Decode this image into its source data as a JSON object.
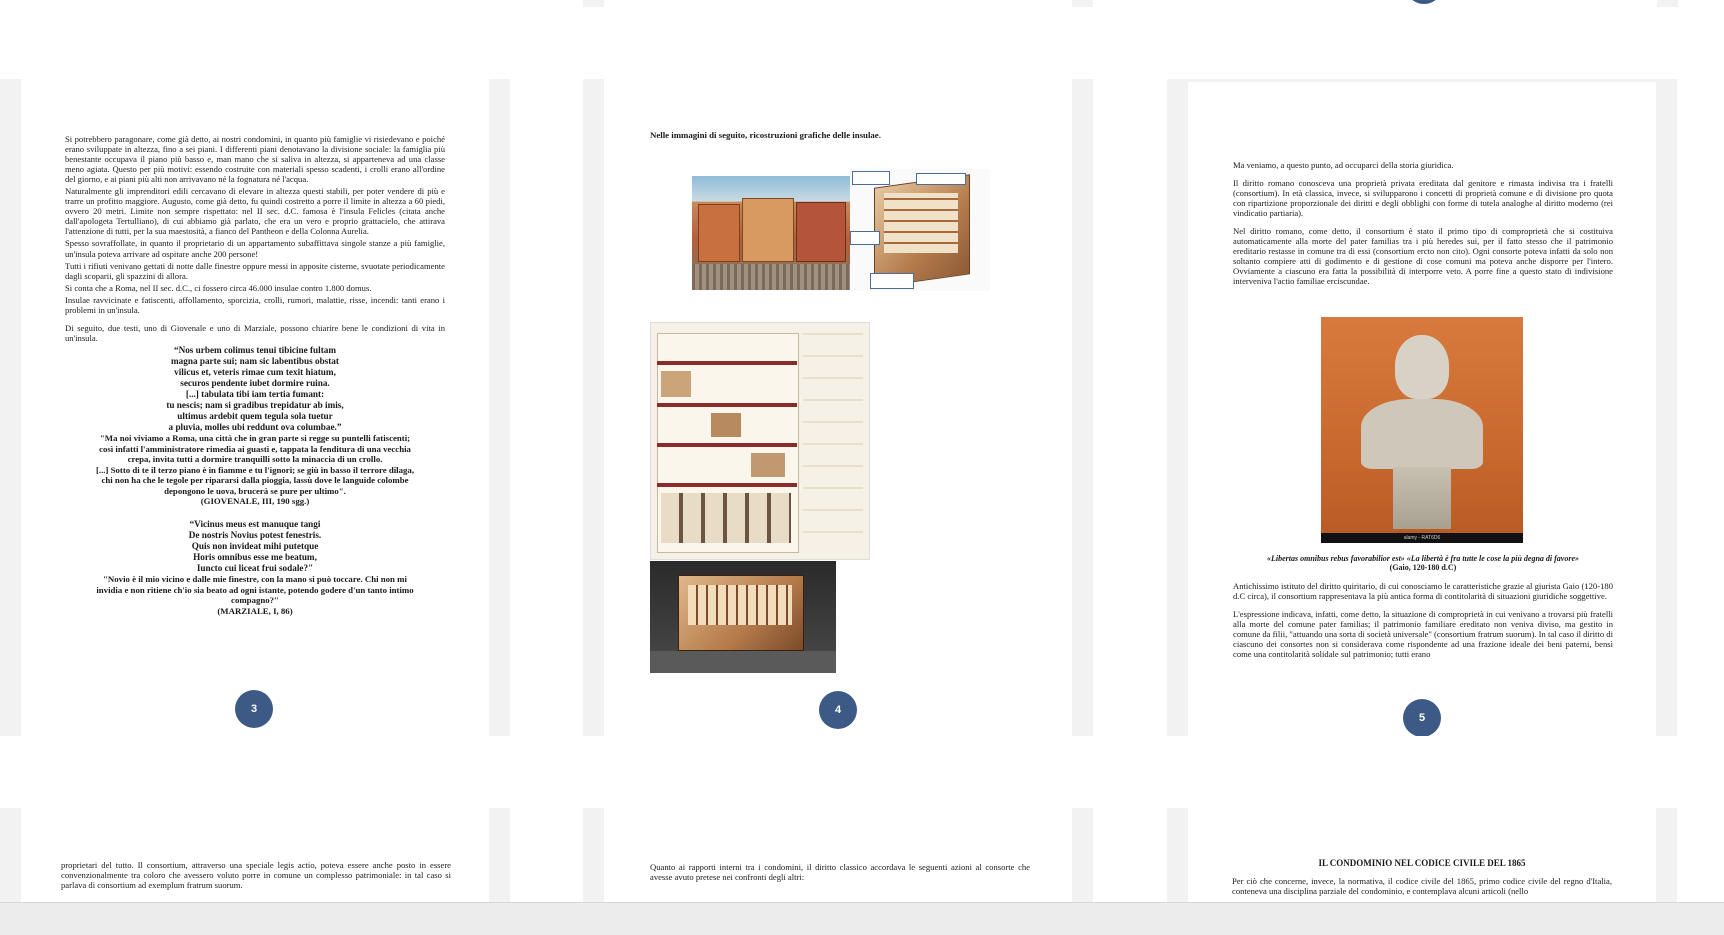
{
  "page3": {
    "number": "3",
    "paragraphs": [
      "Si potrebbero paragonare, come già detto, ai nostri condomini, in quanto più famiglie vi risiedevano e poiché erano sviluppate in altezza, fino a sei piani. I differenti piani denotavano la divisione sociale: la famiglia più benestante occupava il piano più basso e, man mano che si saliva in altezza, si apparteneva ad una classe meno agiata. Questo per più motivi: essendo costruite con materiali spesso scadenti, i crolli erano all'ordine del giorno, e ai piani più alti non arrivavano né la fognatura né l'acqua.",
      "Naturalmente gli imprenditori edili cercavano di elevare in altezza questi stabili, per poter vendere di più e trarre un profitto maggiore. Augusto, come già detto, fu quindi costretto a porre il limite in altezza a 60 piedi, ovvero 20 metri. Limite non sempre rispettato: nel II sec. d.C. famosa è l'insula Felicles (citata anche dall'apologeta Tertulliano), di cui abbiamo già parlato, che era un vero e proprio grattacielo, che attirava l'attenzione di tutti, per la sua maestosità, a fianco del Pantheon e della Colonna Aurelia.",
      "Spesso sovraffollate, in quanto il proprietario di un appartamento subaffittava singole stanze a più famiglie, un'insula poteva arrivare ad ospitare anche 200 persone!",
      "Tutti i rifiuti venivano gettati di notte dalle finestre oppure messi in apposite cisterne, svuotate periodicamente dagli scoparii, gli spazzini di allora.",
      "Si conta che a Roma, nel II sec. d.C., ci fossero circa 46.000 insulae contro 1.800 domus.",
      "Insulae ravvicinate e fatiscenti, affollamento, sporcizia, crolli, rumori, malattie, risse, incendi: tanti erano i problemi in un'insula."
    ],
    "intro_poems": "Di seguito, due testi, uno di Giovenale e uno di Marziale, possono chiarire bene le condizioni di vita in un'insula.",
    "juvenal_latin": [
      "“Nos urbem colimus tenui tibicine fultam",
      "magna parte sui; nam sic labentibus obstat",
      "vilicus et, veteris rimae cum texit hiatum,",
      "securos pendente iubet dormire ruina.",
      "[...] tabulata tibi iam tertia fumant:",
      "tu nescis; nam si gradibus trepidatur ab imis,",
      "ultimus ardebit quem tegula sola tuetur",
      "a pluvia, molles ubi reddunt ova columbae.”"
    ],
    "juvenal_italian": [
      "\"Ma noi viviamo a Roma, una città che in gran parte si regge su puntelli fatiscenti;",
      "così infatti l'amministratore rimedia ai guasti e, tappata la fenditura di una vecchia",
      "crepa, invita tutti a dormire tranquilli sotto la minaccia di un crollo.",
      "[...] Sotto di te il terzo piano è in fiamme e tu l'ignori; se giù in basso il terrore dilaga,",
      "chi non ha che le tegole per ripararsi dalla pioggia, lassù dove le languide colombe",
      "depongono le uova, brucerà se pure per ultimo\"."
    ],
    "juvenal_ref": "(GIOVENALE, III, 190 sgg.)",
    "martial_latin": [
      "“Vicinus meus est manuque tangi",
      "De nostris Novius potest fenestris.",
      "Quis non invideat mihi putetque",
      "Horis omnibus esse me beatum,",
      "Iuncto cui liceat frui sodale?\""
    ],
    "martial_italian": [
      "\"Novio è il mio vicino e dalle mie finestre, con la mano si può toccare. Chi non mi",
      "invidia e non ritiene ch'io sia beato ad ogni istante, potendo godere d'un tanto intimo",
      "compagno?\""
    ],
    "martial_ref": "(MARZIALE, I, 86)"
  },
  "page4": {
    "number": "4",
    "heading": "Nelle immagini di seguito, ricostruzioni grafiche delle insulae."
  },
  "page5": {
    "number": "5",
    "p1": "Ma veniamo, a questo punto, ad occuparci della storia giuridica.",
    "p2": "Il diritto romano conosceva una proprietà privata ereditata dal genitore e rimasta indivisa tra i fratelli (consortium). In età classica, invece, si svilupparono i concetti di proprietà comune e di divisione pro quota con ripartizione proporzionale dei diritti e degli obblighi con forme di tutela analoghe al diritto moderno (rei vindicatio partiaria).",
    "p3": "Nel diritto romano, come detto, il consortium è stato il primo tipo di comproprietà che si costituiva automaticamente alla morte del pater familias tra i più heredes sui, per il fatto stesso che il patrimonio ereditario restasse in comune tra di essi (consortium ercto non cito). Ogni consorte poteva infatti da solo non soltanto compiere atti di godimento e di gestione di cose comuni ma poteva anche disporre per l'intero. Ovviamente a ciascuno era fatta la possibilità di interporre veto. A porre fine a questo stato di indivisione interveniva l'actio familiae erciscundae.",
    "image_watermark": "alamy - RAT6D6",
    "caption": "«Libertas omnibus rebus favorabilior est» «La libertà è fra tutte le cose la più degna di favore»",
    "caption_ref": "(Gaio, 120-180 d.C)",
    "p4": "Antichissimo istituto del diritto quiritario, di cui conosciamo le caratteristiche grazie al giurista Gaio (120-180 d.C circa), il consortium rappresentava la più antica forma di contitolarità di situazioni giuridiche soggettive.",
    "p5": "L'espressione indicava, infatti, come detto, la situazione di comproprietà in cui venivano a trovarsi più fratelli alla morte del comune pater familias; il patrimonio familiare ereditato non veniva diviso, ma gestito in comune da filii, \"attuando una sorta di società universale\" (consortium fratrum suorum). In tal caso il diritto di ciascuno dei consortes non si considerava come rispondente ad una frazione ideale dei beni paterni, bensì come una contitolarità solidale sul patrimonio; tutti erano"
  },
  "page6": {
    "text": "proprietari del tutto. Il consortium, attraverso una speciale legis actio, poteva essere anche posto in essere convenzionalmente tra coloro che avessero voluto porre in comune un complesso patrimoniale: in tal caso si parlava di consortium ad exemplum fratrum suorum."
  },
  "page7": {
    "text": "Quanto ai rapporti interni tra i condomini, il diritto classico accordava le seguenti azioni al consorte che avesse avuto pretese nei confronti degli altri:"
  },
  "page8": {
    "heading": "IL CONDOMINIO NEL CODICE CIVILE DEL 1865",
    "text": "Per ciò che concerne, invece, la normativa, il codice civile del 1865, primo codice civile del regno d'Italia, conteneva una disciplina parziale del condominio, e contemplava alcuni articoli (nello"
  },
  "colors": {
    "badge": "#3c5a85",
    "sheet": "#f2f2f2"
  }
}
